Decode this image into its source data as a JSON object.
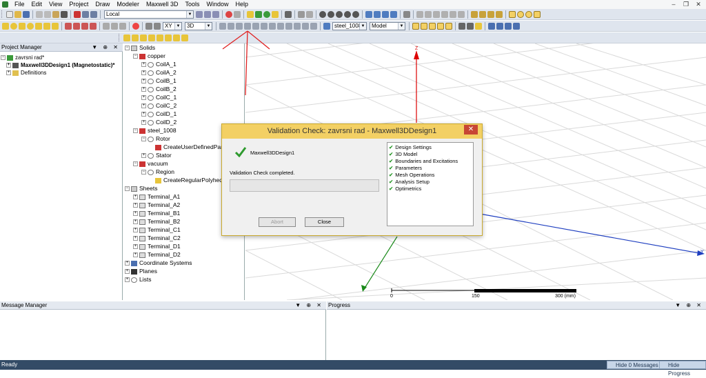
{
  "menu": {
    "items": [
      "File",
      "Edit",
      "View",
      "Project",
      "Draw",
      "Modeler",
      "Maxwell 3D",
      "Tools",
      "Window",
      "Help"
    ],
    "window_controls": [
      "–",
      "❐",
      "✕"
    ]
  },
  "toolbar": {
    "coord_system": "Local",
    "plane": "XY",
    "mode": "3D",
    "material": "steel_1008",
    "model": "Model"
  },
  "project_manager": {
    "title": "Project Manager",
    "project": "zavrsni rad*",
    "design": "Maxwell3DDesign1 (Magnetostatic)*",
    "definitions": "Definitions"
  },
  "history_tree": {
    "solids": "Solids",
    "copper": "copper",
    "copper_items": [
      "CoilA_1",
      "CoilA_2",
      "CoilB_1",
      "CoilB_2",
      "CoilC_1",
      "CoilC_2",
      "CoilD_1",
      "CoilD_2"
    ],
    "steel": "steel_1008",
    "rotor": "Rotor",
    "rotor_child": "CreateUserDefinedPart",
    "stator": "Stator",
    "vacuum": "vacuum",
    "region": "Region",
    "region_child": "CreateRegularPolyhedron",
    "sheets": "Sheets",
    "sheet_items": [
      "Terminal_A1",
      "Terminal_A2",
      "Terminal_B1",
      "Terminal_B2",
      "Terminal_C1",
      "Terminal_C2",
      "Terminal_D1",
      "Terminal_D2"
    ],
    "coordinate_systems": "Coordinate Systems",
    "planes": "Planes",
    "lists": "Lists"
  },
  "viewport": {
    "z_label": "Z",
    "y_label": "Y",
    "scale": [
      "0",
      "150",
      "300 (mm)"
    ]
  },
  "dialog": {
    "title": "Validation Check: zavrsni rad - Maxwell3DDesign1",
    "close_x": "✕",
    "design_name": "Maxwell3DDesign1",
    "status": "Validation Check completed.",
    "abort": "Abort",
    "close": "Close",
    "checks": [
      "Design Settings",
      "3D Model",
      "Boundaries and Excitations",
      "Parameters",
      "Mesh Operations",
      "Analysis Setup",
      "Optimetrics"
    ]
  },
  "message_manager": {
    "title": "Message Manager"
  },
  "progress": {
    "title": "Progress"
  },
  "status_bar": {
    "text": "Ready",
    "hide_messages": "Hide 0 Messages",
    "hide_progress": "Hide Progress"
  },
  "colors": {
    "accent": "#f3d064",
    "check": "#2e9a2e",
    "status": "#334b66"
  }
}
